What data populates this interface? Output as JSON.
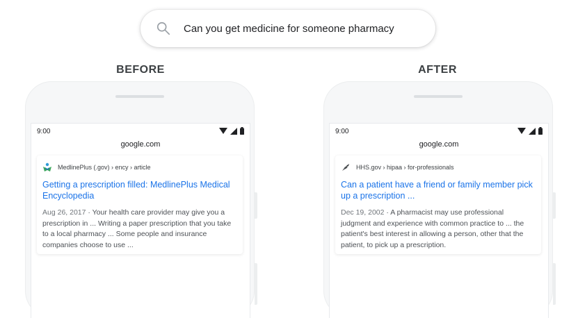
{
  "search": {
    "query": "Can you get medicine for someone pharmacy",
    "icon": "search-icon"
  },
  "before": {
    "label": "BEFORE",
    "status_time": "9:00",
    "url": "google.com",
    "result": {
      "favicon": "medlineplus-icon",
      "breadcrumb": "MedlinePlus (.gov) › ency › article",
      "title": "Getting a prescription filled: MedlinePlus Medical Encyclopedia",
      "date": "Aug 26, 2017",
      "snippet": "Your health care provider may give you a prescription in ... Writing a paper prescription that you take to a local pharmacy ... Some people and insurance companies choose to use ..."
    }
  },
  "after": {
    "label": "AFTER",
    "status_time": "9:00",
    "url": "google.com",
    "result": {
      "favicon": "hhs-eagle-icon",
      "breadcrumb": "HHS.gov › hipaa › for-professionals",
      "title": "Can a patient have a friend or family member pick up a prescription ...",
      "date": "Dec 19, 2002",
      "snippet": "A pharmacist may use professional judgment and experience with common practice to ... the patient's best interest in allowing a person, other that the patient, to pick up a prescription."
    }
  },
  "colors": {
    "link": "#1a73e8",
    "snippet": "#4d5156",
    "phone_body": "#f6f7f8"
  }
}
